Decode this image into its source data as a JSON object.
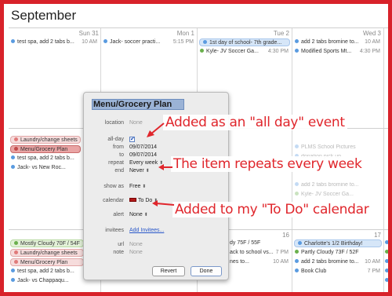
{
  "month_title": "September",
  "colors": {
    "frame": "#d8222a",
    "accent_red": "#e0262c",
    "event_blue": "#5a9be0",
    "event_green": "#6ab04c",
    "event_pink": "#e07a7a",
    "selection": "#9bb3d6"
  },
  "week1": {
    "days": [
      "Sun 31",
      "Mon 1",
      "Tue 2",
      "Wed 3"
    ],
    "events": [
      {
        "title": "test spa, add 2 tabs b...",
        "time": "10 AM",
        "dot": "#5a9be0"
      },
      {
        "title": "Jack- soccer practi...",
        "time": "5:15 PM",
        "dot": "#5a9be0"
      },
      {
        "title": "1st day of school- 7th grade...",
        "time": "",
        "dot": "#5a9be0"
      },
      {
        "title": "Kyle- JV Soccer Ga...",
        "time": "4:30 PM",
        "dot": "#6ab04c"
      },
      {
        "title": "add 2 tabs bromine to...",
        "time": "10 AM",
        "dot": "#5a9be0"
      },
      {
        "title": "Modified Sports Mt...",
        "time": "4:30 PM",
        "dot": "#5a9be0"
      }
    ]
  },
  "week2": {
    "events": [
      {
        "title": "Laundry/change sheets",
        "dot": "#e07a7a"
      },
      {
        "title": "Menu/Grocery Plan",
        "dot": "#e07a7a"
      },
      {
        "title": "test spa, add 2 tabs b...",
        "time": "10 AM",
        "dot": "#5a9be0"
      },
      {
        "title": "Jack- vs New Roc...",
        "time": "5 PM",
        "dot": "#5a9be0"
      }
    ],
    "faded": [
      "PLMS School Pictures",
      "donation pick up",
      "add 2 tabs bromine to...",
      "Kyle- JV Soccer Ga..."
    ]
  },
  "week3": {
    "day_numbers": [
      "16",
      "17"
    ],
    "events": [
      {
        "title": "Mostly Cloudy 70F / 54F",
        "dot": "#6ab04c"
      },
      {
        "title": "Laundry/change sheets",
        "dot": "#e07a7a"
      },
      {
        "title": "Menu/Grocery Plan",
        "dot": "#e07a7a"
      },
      {
        "title": "test spa, add 2 tabs b...",
        "time": "10 AM",
        "dot": "#5a9be0"
      },
      {
        "title": "Jack- vs Chappaqu...",
        "time": "4 PM",
        "dot": "#5a9be0"
      },
      {
        "title": "dy 75F / 55F",
        "dot": "#6ab04c"
      },
      {
        "title": "ack to school vs...",
        "time": "7 PM",
        "dot": "#5a9be0"
      },
      {
        "title": "nes to...",
        "time": "10 AM",
        "dot": "#5a9be0"
      },
      {
        "title": "Charlotte's 1/2 Birthday!",
        "dot": "#5a9be0"
      },
      {
        "title": "Partly Cloudy 73F / 52F",
        "dot": "#6ab04c"
      },
      {
        "title": "add 2 tabs bromine to...",
        "time": "10 AM",
        "dot": "#5a9be0"
      },
      {
        "title": "Book Club",
        "time": "7 PM",
        "dot": "#5a9be0"
      }
    ],
    "edge_letters": [
      "C",
      "P",
      "H",
      "K",
      "F"
    ]
  },
  "dialog": {
    "title": "Menu/Grocery Plan",
    "location_label": "location",
    "location_value": "None",
    "allday_label": "all-day",
    "allday_check": "✔",
    "from_label": "from",
    "from_value": "09/07/2014",
    "to_label": "to",
    "to_value": "09/07/2014",
    "repeat_label": "repeat",
    "repeat_value": "Every week",
    "end_label": "end",
    "end_value": "Never",
    "showas_label": "show as",
    "showas_value": "Free",
    "calendar_label": "calendar",
    "calendar_value": "To Do",
    "alert_label": "alert",
    "alert_value": "None",
    "invitees_label": "invitees",
    "invitees_value": "Add Invitees...",
    "url_label": "url",
    "url_value": "None",
    "note_label": "note",
    "note_value": "None",
    "revert_label": "Revert",
    "done_label": "Done"
  },
  "callouts": {
    "allday": "Added as an \"all day\" event",
    "repeats": "The item repeats every week",
    "todo": "Added to my \"To Do\" calendar"
  }
}
